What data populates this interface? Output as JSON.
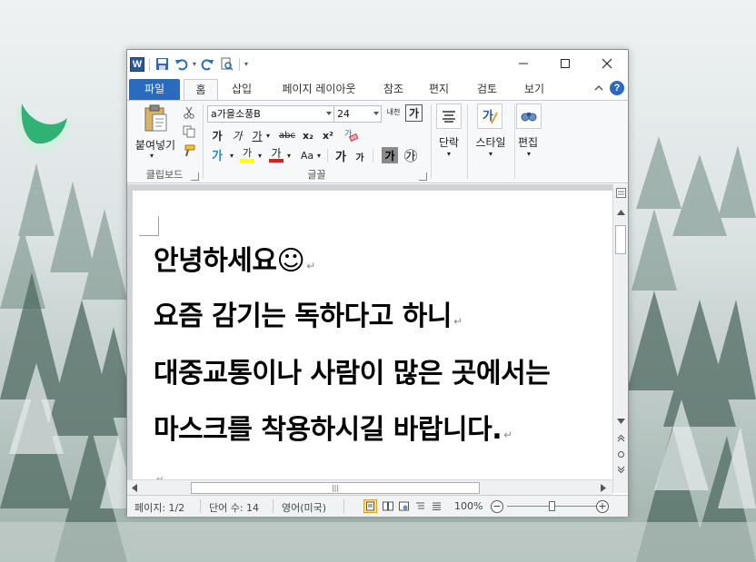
{
  "qat": {
    "app_icon_letter": "W",
    "customize_label": "▾"
  },
  "tabs": {
    "file": "파일",
    "home": "홈",
    "insert": "삽입",
    "page_layout": "페이지 레이아웃",
    "references": "참조",
    "mailings": "편지",
    "review": "검토",
    "view": "보기",
    "help": "?"
  },
  "ribbon": {
    "clipboard": {
      "paste_label": "붙여넣기",
      "group_label": "클립보드"
    },
    "font": {
      "font_name": "a가을소풍B",
      "font_size": "24",
      "phonetic_label": "내천",
      "char_border_label": "가",
      "bold": "가",
      "italic": "가",
      "underline": "가",
      "strike": "abc",
      "subscript": "x₂",
      "superscript": "x²",
      "highlight": "가",
      "font_color": "가",
      "change_case": "Aa",
      "grow": "가",
      "shrink": "가",
      "shading": "가",
      "enclose": "㉮",
      "group_label": "글꼴"
    },
    "paragraph": {
      "label": "단락"
    },
    "styles": {
      "label": "스타일"
    },
    "editing": {
      "label": "편집"
    }
  },
  "document": {
    "lines": [
      "안녕하세요☺",
      "요즘 감기는 독하다고 하니",
      "대중교통이나 사람이 많은 곳에서는",
      "마스크를 착용하시길 바랍니다."
    ],
    "paragraph_mark": "↵"
  },
  "statusbar": {
    "page": "페이지: 1/2",
    "words": "단어 수: 14",
    "language": "영어(미국)",
    "zoom": "100%",
    "zoom_out": "−",
    "zoom_in": "+",
    "zoom_fraction": 0.5
  },
  "colors": {
    "file_tab": "#2b6bbf",
    "highlight": "#ffff00",
    "font_color": "#e02020",
    "word_blue": "#2b579a"
  }
}
